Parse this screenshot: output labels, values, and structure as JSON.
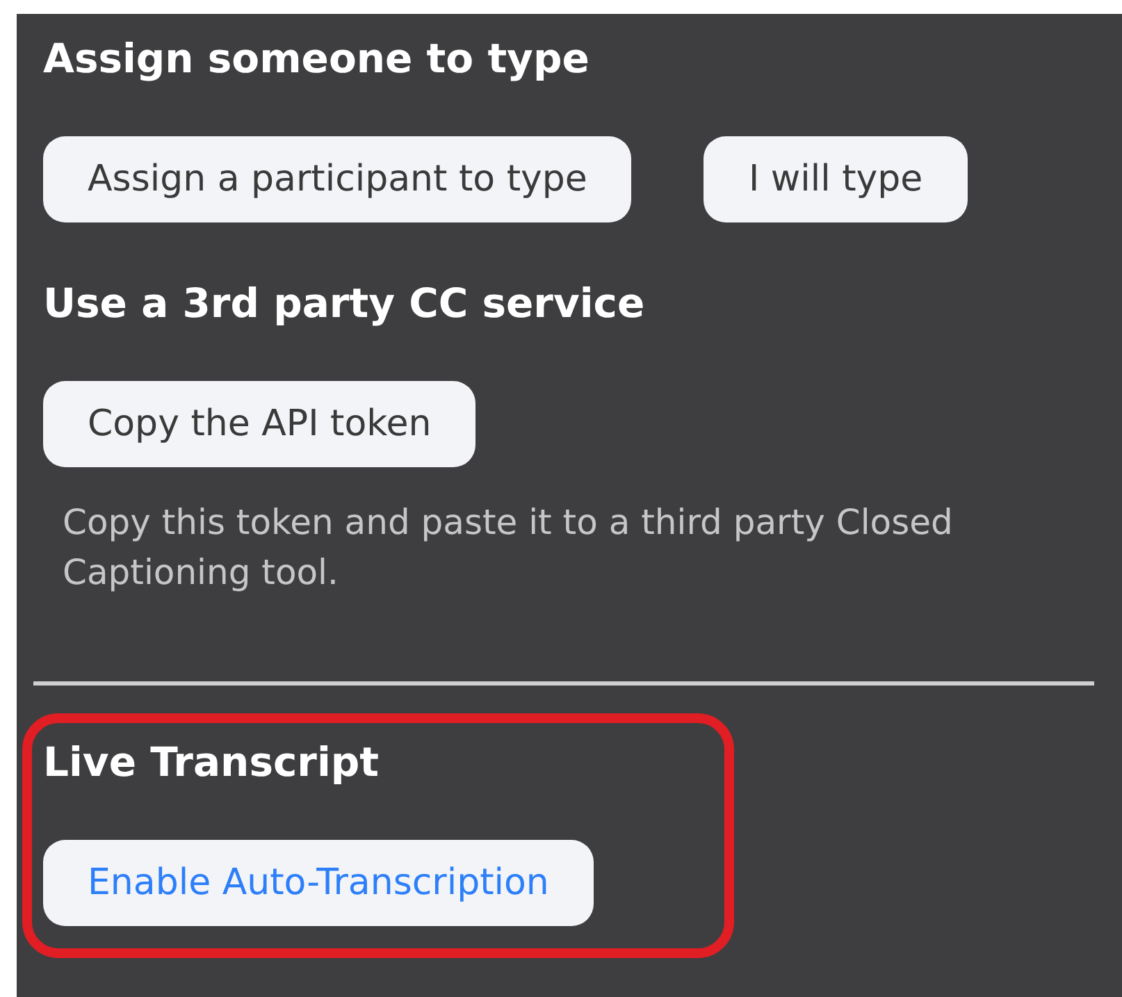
{
  "sections": [
    {
      "title": "Assign someone to type",
      "buttons": [
        {
          "label": "Assign a participant to type"
        },
        {
          "label": "I will type"
        }
      ]
    },
    {
      "title": "Use a 3rd party CC service",
      "buttons": [
        {
          "label": "Copy the API token"
        }
      ],
      "description": "Copy this token and paste it to a third party Closed Captioning tool."
    },
    {
      "title": "Live Transcript",
      "highlighted": true,
      "buttons": [
        {
          "label": "Enable Auto-Transcription",
          "kind": "link"
        }
      ]
    }
  ]
}
